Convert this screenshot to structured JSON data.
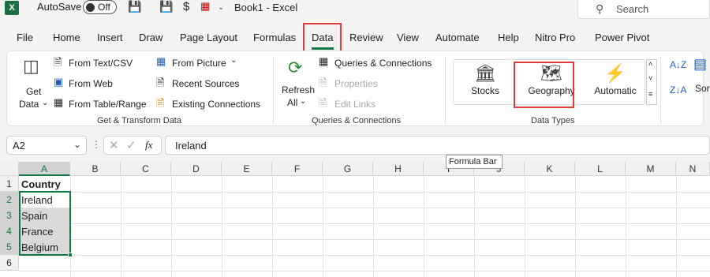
{
  "titlebar": {
    "app_logo": "X",
    "autosave_label": "AutoSave",
    "autosave_state": "Off",
    "title": "Book1  -  Excel",
    "search_placeholder": "Search"
  },
  "tabs": [
    "File",
    "Home",
    "Insert",
    "Draw",
    "Page Layout",
    "Formulas",
    "Data",
    "Review",
    "View",
    "Automate",
    "Help",
    "Nitro Pro",
    "Power Pivot"
  ],
  "active_tab": "Data",
  "ribbon": {
    "get_transform": {
      "get_data_line1": "Get",
      "get_data_line2": "Data",
      "from_text_csv": "From Text/CSV",
      "from_web": "From Web",
      "from_table_range": "From Table/Range",
      "from_picture": "From Picture",
      "recent_sources": "Recent Sources",
      "existing_connections": "Existing Connections",
      "group_label": "Get & Transform Data"
    },
    "queries": {
      "refresh_line1": "Refresh",
      "refresh_line2": "All",
      "queries_connections": "Queries & Connections",
      "properties": "Properties",
      "edit_links": "Edit Links",
      "group_label": "Queries & Connections"
    },
    "data_types": {
      "stocks": "Stocks",
      "geography": "Geography",
      "automatic": "Automatic",
      "group_label": "Data Types"
    },
    "sort": {
      "sort_label": "Sort"
    }
  },
  "formula_bar": {
    "name_box": "A2",
    "fx": "fx",
    "value": "Ireland",
    "tooltip": "Formula Bar"
  },
  "grid": {
    "columns": [
      "A",
      "B",
      "C",
      "D",
      "E",
      "F",
      "G",
      "H",
      "I",
      "J",
      "K",
      "L",
      "M",
      "N"
    ],
    "rows": [
      "1",
      "2",
      "3",
      "4",
      "5",
      "6"
    ],
    "cells": [
      "Country",
      "Ireland",
      "Spain",
      "France",
      "Belgium"
    ]
  },
  "colors": {
    "excel_green": "#107c41",
    "highlight_red": "#e23a3a",
    "selection_gray": "#d9d9d9"
  }
}
